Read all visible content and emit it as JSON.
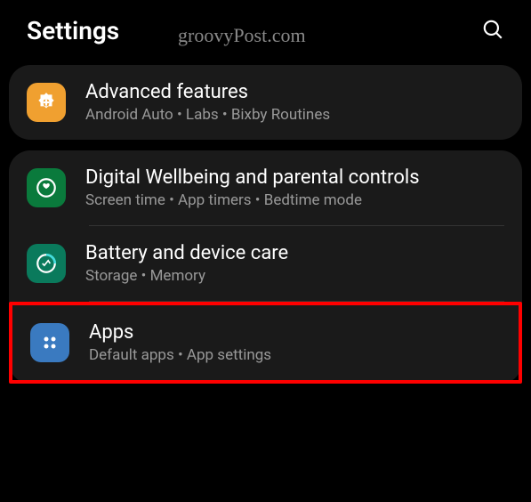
{
  "header": {
    "title": "Settings"
  },
  "watermark": "groovyPost.com",
  "card1": {
    "item1": {
      "title": "Advanced features",
      "sub": "Android Auto  •  Labs  •  Bixby Routines"
    }
  },
  "card2": {
    "item1": {
      "title": "Digital Wellbeing and parental controls",
      "sub": "Screen time  •  App timers  •  Bedtime mode"
    },
    "item2": {
      "title": "Battery and device care",
      "sub": "Storage  •  Memory"
    },
    "item3": {
      "title": "Apps",
      "sub": "Default apps  •  App settings"
    }
  }
}
